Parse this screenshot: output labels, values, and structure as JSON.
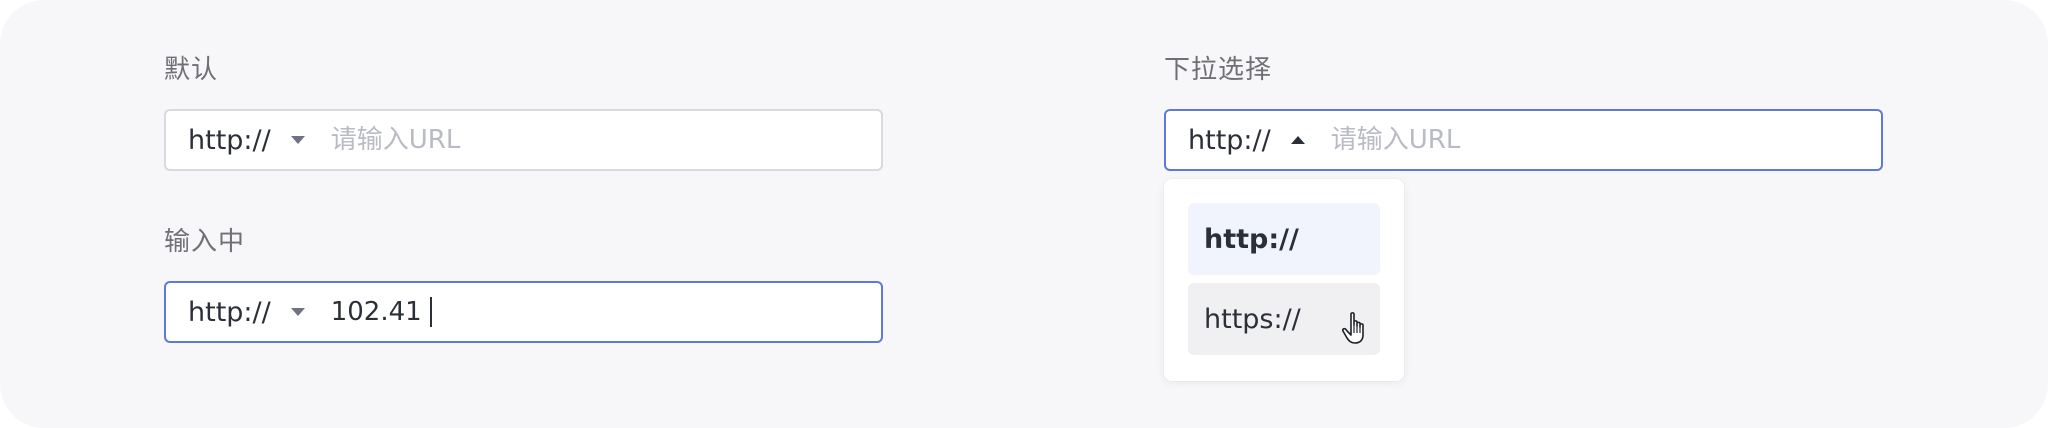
{
  "sections": {
    "default": {
      "label": "默认",
      "protocol": "http://",
      "placeholder": "请输入URL"
    },
    "typing": {
      "label": "输入中",
      "protocol": "http://",
      "value": "102.41"
    },
    "dropdown": {
      "label": "下拉选择",
      "protocol": "http://",
      "placeholder": "请输入URL",
      "options": [
        {
          "label": "http://",
          "state": "selected"
        },
        {
          "label": "https://",
          "state": "hovered"
        }
      ]
    }
  },
  "icons": {
    "caret_closed": "chevron-down-icon",
    "caret_open": "chevron-up-icon",
    "pointer": "hand-pointer-icon"
  },
  "colors": {
    "active_border": "#5b7bd6",
    "default_border": "#d9d9de",
    "selected_option_bg": "#f1f4fd",
    "hover_option_bg": "#f0f0f2"
  }
}
